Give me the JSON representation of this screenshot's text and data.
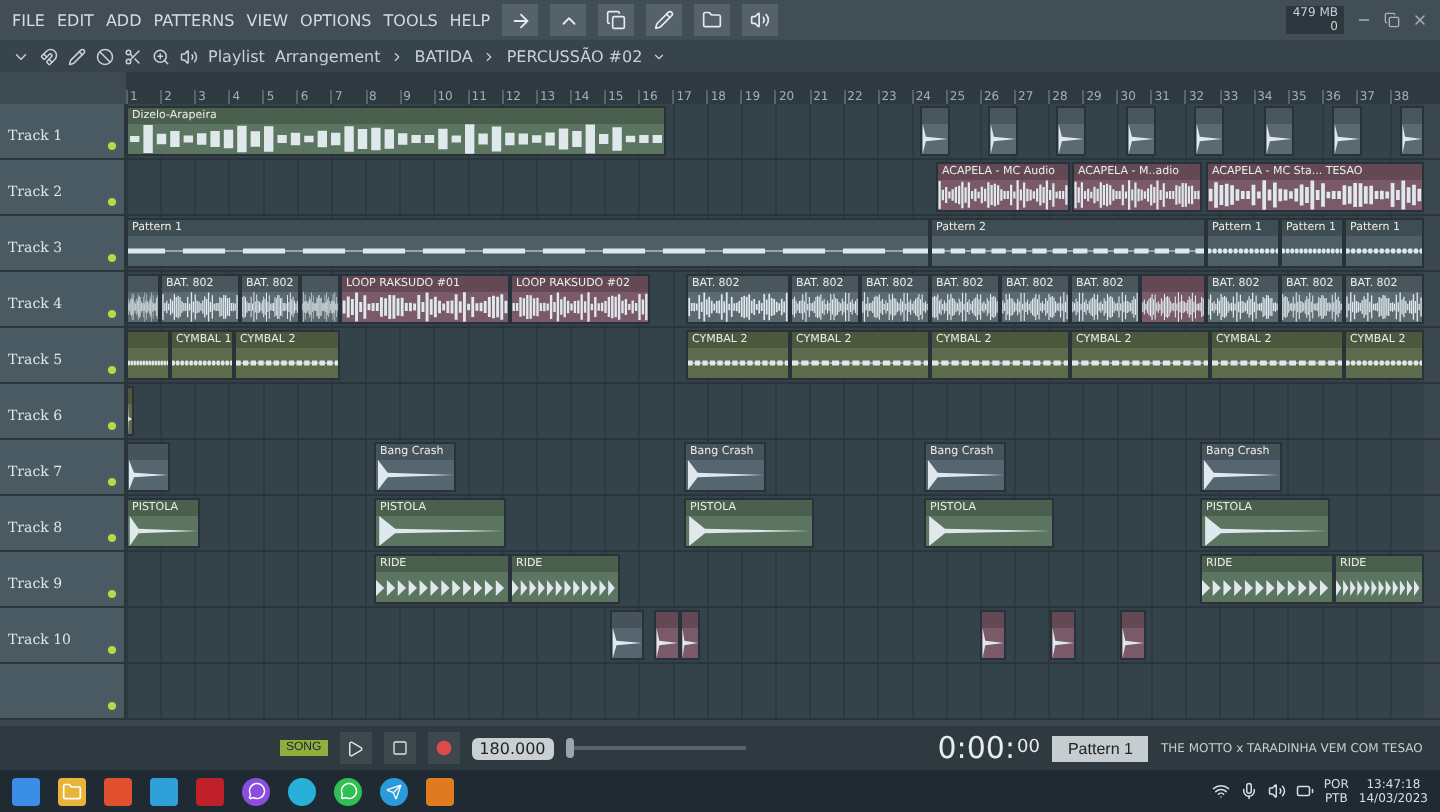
{
  "menu": [
    "FILE",
    "EDIT",
    "ADD",
    "PATTERNS",
    "VIEW",
    "OPTIONS",
    "TOOLS",
    "HELP"
  ],
  "memory": {
    "usage": "479 MB",
    "voices": "0"
  },
  "playlist": {
    "title": "Playlist",
    "crumbs": [
      "Arrangement",
      "BATIDA",
      "PERCUSSÃO #02"
    ]
  },
  "ruler": [
    "1",
    "2",
    "3",
    "4",
    "5",
    "6",
    "7",
    "8",
    "9",
    "10",
    "11",
    "12",
    "13",
    "14",
    "15",
    "16",
    "17",
    "18",
    "19",
    "20",
    "21",
    "22",
    "23",
    "24",
    "25",
    "26",
    "27",
    "28",
    "29",
    "30",
    "31",
    "32",
    "33",
    "34",
    "35",
    "36",
    "37",
    "38"
  ],
  "tracks": [
    {
      "name": "Track 1",
      "clips": [
        {
          "name": "Dizelo-Arapeira",
          "kind": "wave",
          "color": "#5b7560"
        },
        {
          "kind": "hit",
          "color": "#5a6a70"
        },
        {
          "kind": "hit",
          "color": "#5a6a70"
        },
        {
          "kind": "hit",
          "color": "#5a6a70"
        },
        {
          "kind": "hit",
          "color": "#5a6a70"
        },
        {
          "kind": "hit",
          "color": "#5a6a70"
        },
        {
          "kind": "hit",
          "color": "#5a6a70"
        },
        {
          "kind": "hit",
          "color": "#5a6a70"
        },
        {
          "kind": "hit",
          "color": "#5a6a70"
        }
      ]
    },
    {
      "name": "Track 2",
      "clips": [
        {
          "name": "ACAPELA - MC Audio",
          "kind": "wave",
          "color": "#7a5a68"
        },
        {
          "name": "ACAPELA - M..adio",
          "kind": "wave",
          "color": "#7a5a68"
        },
        {
          "name": "ACAPELA - MC Sta... TESAO",
          "kind": "wave",
          "color": "#7a5a68"
        }
      ]
    },
    {
      "name": "Track 3",
      "clips": [
        {
          "name": "Pattern 1",
          "kind": "notes",
          "color": "#4e5e66"
        },
        {
          "name": "Pattern 2",
          "kind": "notes",
          "color": "#4e5e66"
        },
        {
          "name": "Pattern 1",
          "kind": "notes",
          "color": "#4e5e66"
        },
        {
          "name": "Pattern 1",
          "kind": "notes",
          "color": "#4e5e66"
        },
        {
          "name": "Pattern 1",
          "kind": "notes",
          "color": "#4e5e66"
        }
      ]
    },
    {
      "name": "Track 4",
      "clips": [
        {
          "kind": "wave",
          "color": "#5a6a70"
        },
        {
          "name": "BAT. 802",
          "kind": "wave",
          "color": "#5a6a70"
        },
        {
          "name": "BAT. 802",
          "kind": "wave",
          "color": "#5a6a70"
        },
        {
          "kind": "wave",
          "color": "#5a6a70"
        },
        {
          "name": "LOOP RAKSUDO #01",
          "kind": "wave",
          "color": "#7a5a68"
        },
        {
          "name": "LOOP RAKSUDO #02",
          "kind": "wave",
          "color": "#7a5a68"
        },
        {
          "name": "BAT. 802",
          "kind": "wave",
          "color": "#5a6a70"
        },
        {
          "name": "BAT. 802",
          "kind": "wave",
          "color": "#5a6a70"
        },
        {
          "name": "BAT. 802",
          "kind": "wave",
          "color": "#5a6a70"
        },
        {
          "name": "BAT. 802",
          "kind": "wave",
          "color": "#5a6a70"
        },
        {
          "name": "BAT. 802",
          "kind": "wave",
          "color": "#5a6a70"
        },
        {
          "name": "BAT. 802",
          "kind": "wave",
          "color": "#5a6a70"
        },
        {
          "kind": "wave",
          "color": "#7a5a68"
        },
        {
          "name": "BAT. 802",
          "kind": "wave",
          "color": "#5a6a70"
        },
        {
          "name": "BAT. 802",
          "kind": "wave",
          "color": "#5a6a70"
        },
        {
          "name": "BAT. 802",
          "kind": "wave",
          "color": "#5a6a70"
        }
      ]
    },
    {
      "name": "Track 5",
      "clips": [
        {
          "kind": "notes",
          "color": "#5d6b4c"
        },
        {
          "name": "CYMBAL 1",
          "kind": "notes",
          "color": "#5d6b4c"
        },
        {
          "name": "CYMBAL 2",
          "kind": "notes",
          "color": "#5d6b4c"
        },
        {
          "name": "CYMBAL 2",
          "kind": "notes",
          "color": "#5d6b4c"
        },
        {
          "name": "CYMBAL 2",
          "kind": "notes",
          "color": "#5d6b4c"
        },
        {
          "name": "CYMBAL 2",
          "kind": "notes",
          "color": "#5d6b4c"
        },
        {
          "name": "CYMBAL 2",
          "kind": "notes",
          "color": "#5d6b4c"
        },
        {
          "name": "CYMBAL 2",
          "kind": "notes",
          "color": "#5d6b4c"
        },
        {
          "name": "CYMBAL 2",
          "kind": "notes",
          "color": "#5d6b4c"
        }
      ]
    },
    {
      "name": "Track 6",
      "clips": [
        {
          "kind": "hit",
          "color": "#5d6b4c"
        }
      ]
    },
    {
      "name": "Track 7",
      "clips": [
        {
          "kind": "hit",
          "color": "#566670"
        },
        {
          "name": "Bang Crash",
          "kind": "hit",
          "color": "#566670"
        },
        {
          "name": "Bang Crash",
          "kind": "hit",
          "color": "#566670"
        },
        {
          "name": "Bang Crash",
          "kind": "hit",
          "color": "#566670"
        },
        {
          "name": "Bang Crash",
          "kind": "hit",
          "color": "#566670"
        }
      ]
    },
    {
      "name": "Track 8",
      "clips": [
        {
          "name": "PISTOLA",
          "kind": "hit",
          "color": "#5b7560"
        },
        {
          "name": "PISTOLA",
          "kind": "hit",
          "color": "#5b7560"
        },
        {
          "name": "PISTOLA",
          "kind": "hit",
          "color": "#5b7560"
        },
        {
          "name": "PISTOLA",
          "kind": "hit",
          "color": "#5b7560"
        },
        {
          "name": "PISTOLA",
          "kind": "hit",
          "color": "#5b7560"
        }
      ]
    },
    {
      "name": "Track 9",
      "clips": [
        {
          "name": "RIDE",
          "kind": "pulse",
          "color": "#5b7560"
        },
        {
          "name": "RIDE",
          "kind": "pulse",
          "color": "#5b7560"
        },
        {
          "name": "RIDE",
          "kind": "pulse",
          "color": "#5b7560"
        },
        {
          "name": "RIDE",
          "kind": "pulse",
          "color": "#5b7560"
        }
      ]
    },
    {
      "name": "Track 10",
      "clips": [
        {
          "kind": "hit",
          "color": "#566670"
        },
        {
          "kind": "hit",
          "color": "#7a5a68"
        },
        {
          "kind": "hit",
          "color": "#7a5a68"
        },
        {
          "kind": "hit",
          "color": "#7a5a68"
        },
        {
          "kind": "hit",
          "color": "#7a5a68"
        },
        {
          "kind": "hit",
          "color": "#7a5a68"
        }
      ]
    }
  ],
  "transport": {
    "mode": "SONG",
    "tempo": "180.000",
    "pitch": {
      "level": 0.03
    },
    "time": "0:00:",
    "time_small": "00",
    "pattern": "Pattern 1",
    "hint": "THE MOTTO x TARADINHA VEM COM TESAO"
  },
  "taskbar": {
    "language": "POR",
    "layout": "PTB",
    "time": "13:47:18",
    "date": "14/03/2023"
  }
}
